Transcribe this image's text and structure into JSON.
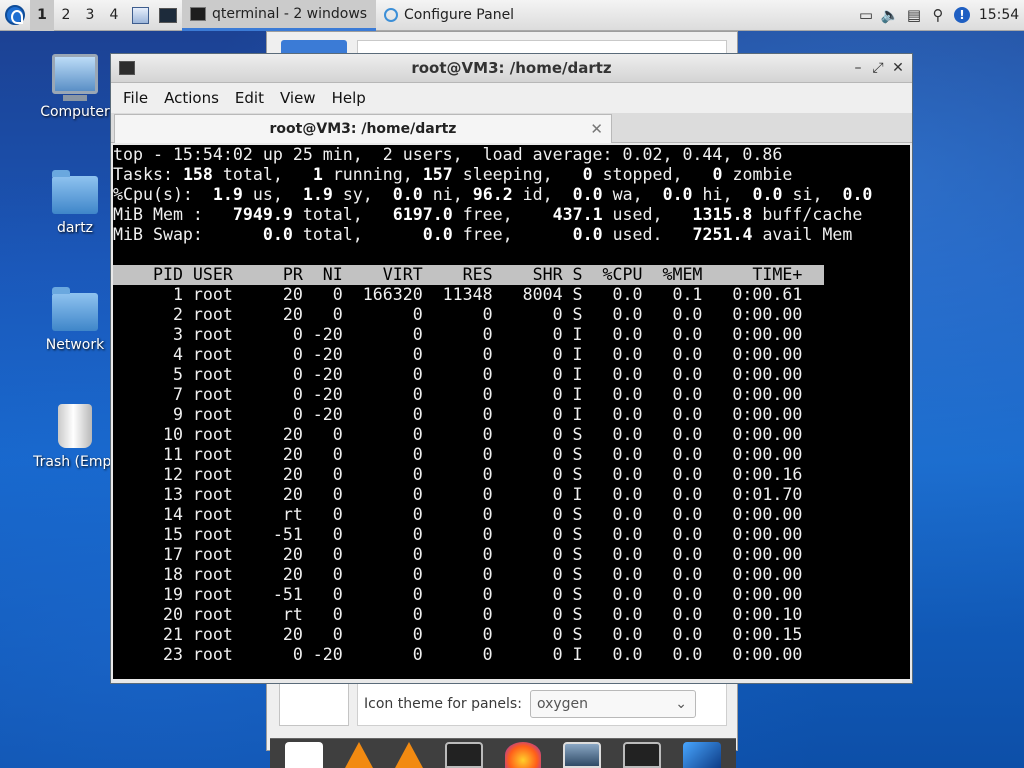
{
  "top_panel": {
    "desktops": [
      "1",
      "2",
      "3",
      "4"
    ],
    "active_desktop": "1",
    "tasks": [
      {
        "label": "qterminal - 2 windows"
      },
      {
        "label": "Configure Panel"
      }
    ],
    "clock": "15:54"
  },
  "desktop_icons": [
    {
      "label": "Computer"
    },
    {
      "label": "dartz"
    },
    {
      "label": "Network"
    },
    {
      "label": "Trash (Empt"
    }
  ],
  "configure_panel": {
    "icon_theme_label": "Icon theme for panels:",
    "icon_theme_value": "oxygen"
  },
  "terminal": {
    "window_title": "root@VM3: /home/dartz",
    "menus": [
      "File",
      "Actions",
      "Edit",
      "View",
      "Help"
    ],
    "tab_title": "root@VM3: /home/dartz",
    "summary": {
      "line1": "top - 15:54:02 up 25 min,  2 users,  load average: 0.02, 0.44, 0.86",
      "tasks": {
        "total": "158",
        "running": "1",
        "sleeping": "157",
        "stopped": "0",
        "zombie": "0"
      },
      "cpu": {
        "us": "1.9",
        "sy": "1.9",
        "ni": "0.0",
        "id": "96.2",
        "wa": "0.0",
        "hi": "0.0",
        "si": "0.0",
        "st": "0.0"
      },
      "mem": {
        "total": "7949.9",
        "free": "6197.0",
        "used": "437.1",
        "buff_cache": "1315.8"
      },
      "swap": {
        "total": "0.0",
        "free": "0.0",
        "used": "0.0",
        "avail": "7251.4"
      }
    },
    "columns": [
      "PID",
      "USER",
      "PR",
      "NI",
      "VIRT",
      "RES",
      "SHR",
      "S",
      "%CPU",
      "%MEM",
      "TIME+"
    ],
    "processes": [
      [
        "1",
        "root",
        "20",
        "0",
        "166320",
        "11348",
        "8004",
        "S",
        "0.0",
        "0.1",
        "0:00.61"
      ],
      [
        "2",
        "root",
        "20",
        "0",
        "0",
        "0",
        "0",
        "S",
        "0.0",
        "0.0",
        "0:00.00"
      ],
      [
        "3",
        "root",
        "0",
        "-20",
        "0",
        "0",
        "0",
        "I",
        "0.0",
        "0.0",
        "0:00.00"
      ],
      [
        "4",
        "root",
        "0",
        "-20",
        "0",
        "0",
        "0",
        "I",
        "0.0",
        "0.0",
        "0:00.00"
      ],
      [
        "5",
        "root",
        "0",
        "-20",
        "0",
        "0",
        "0",
        "I",
        "0.0",
        "0.0",
        "0:00.00"
      ],
      [
        "7",
        "root",
        "0",
        "-20",
        "0",
        "0",
        "0",
        "I",
        "0.0",
        "0.0",
        "0:00.00"
      ],
      [
        "9",
        "root",
        "0",
        "-20",
        "0",
        "0",
        "0",
        "I",
        "0.0",
        "0.0",
        "0:00.00"
      ],
      [
        "10",
        "root",
        "20",
        "0",
        "0",
        "0",
        "0",
        "S",
        "0.0",
        "0.0",
        "0:00.00"
      ],
      [
        "11",
        "root",
        "20",
        "0",
        "0",
        "0",
        "0",
        "S",
        "0.0",
        "0.0",
        "0:00.00"
      ],
      [
        "12",
        "root",
        "20",
        "0",
        "0",
        "0",
        "0",
        "S",
        "0.0",
        "0.0",
        "0:00.16"
      ],
      [
        "13",
        "root",
        "20",
        "0",
        "0",
        "0",
        "0",
        "I",
        "0.0",
        "0.0",
        "0:01.70"
      ],
      [
        "14",
        "root",
        "rt",
        "0",
        "0",
        "0",
        "0",
        "S",
        "0.0",
        "0.0",
        "0:00.00"
      ],
      [
        "15",
        "root",
        "-51",
        "0",
        "0",
        "0",
        "0",
        "S",
        "0.0",
        "0.0",
        "0:00.00"
      ],
      [
        "17",
        "root",
        "20",
        "0",
        "0",
        "0",
        "0",
        "S",
        "0.0",
        "0.0",
        "0:00.00"
      ],
      [
        "18",
        "root",
        "20",
        "0",
        "0",
        "0",
        "0",
        "S",
        "0.0",
        "0.0",
        "0:00.00"
      ],
      [
        "19",
        "root",
        "-51",
        "0",
        "0",
        "0",
        "0",
        "S",
        "0.0",
        "0.0",
        "0:00.00"
      ],
      [
        "20",
        "root",
        "rt",
        "0",
        "0",
        "0",
        "0",
        "S",
        "0.0",
        "0.0",
        "0:00.10"
      ],
      [
        "21",
        "root",
        "20",
        "0",
        "0",
        "0",
        "0",
        "S",
        "0.0",
        "0.0",
        "0:00.15"
      ],
      [
        "23",
        "root",
        "0",
        "-20",
        "0",
        "0",
        "0",
        "I",
        "0.0",
        "0.0",
        "0:00.00"
      ]
    ]
  },
  "dock": {
    "items": [
      "featherpad-icon",
      "vlc-icon",
      "vlc-icon",
      "terminal-icon",
      "firefox-icon",
      "screenshot-icon",
      "terminal-icon",
      "bird-icon"
    ]
  }
}
